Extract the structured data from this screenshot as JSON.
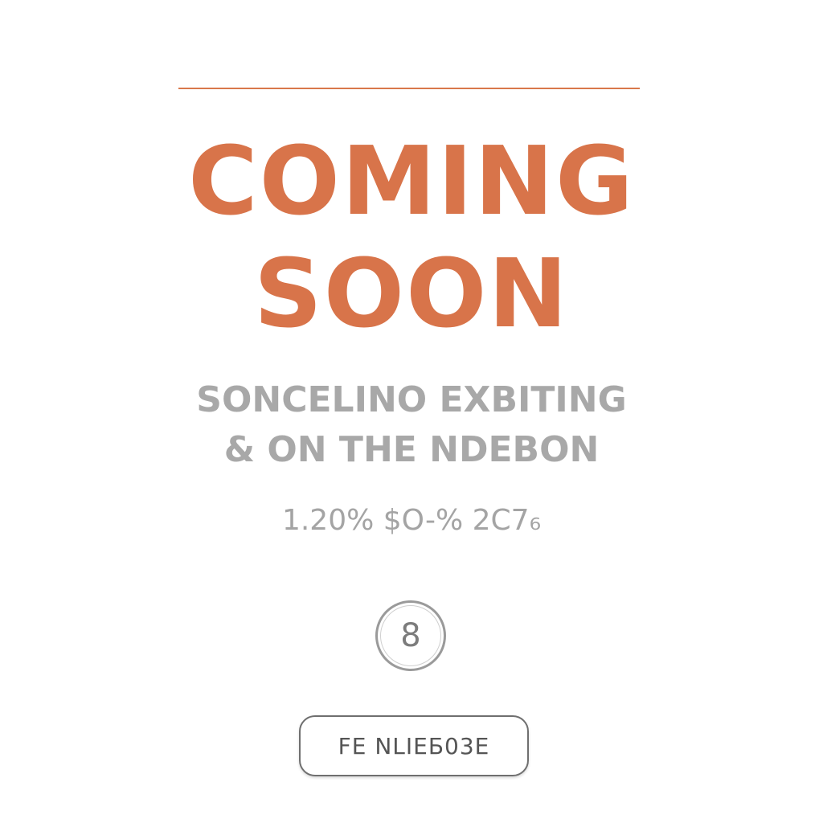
{
  "headline": {
    "line1": "COMING",
    "line2": "SOON"
  },
  "subheadline": {
    "line1": "SONCELINO EXBITING",
    "line2": "& ON THE NDEBON"
  },
  "stats": "1.20% $O-% 2C7₆",
  "badge": "8",
  "cta_label": "FE NLIEБ03E",
  "colors": {
    "accent": "#d8744a",
    "muted_text": "#a8a8a8",
    "border": "#6f6f6f"
  }
}
